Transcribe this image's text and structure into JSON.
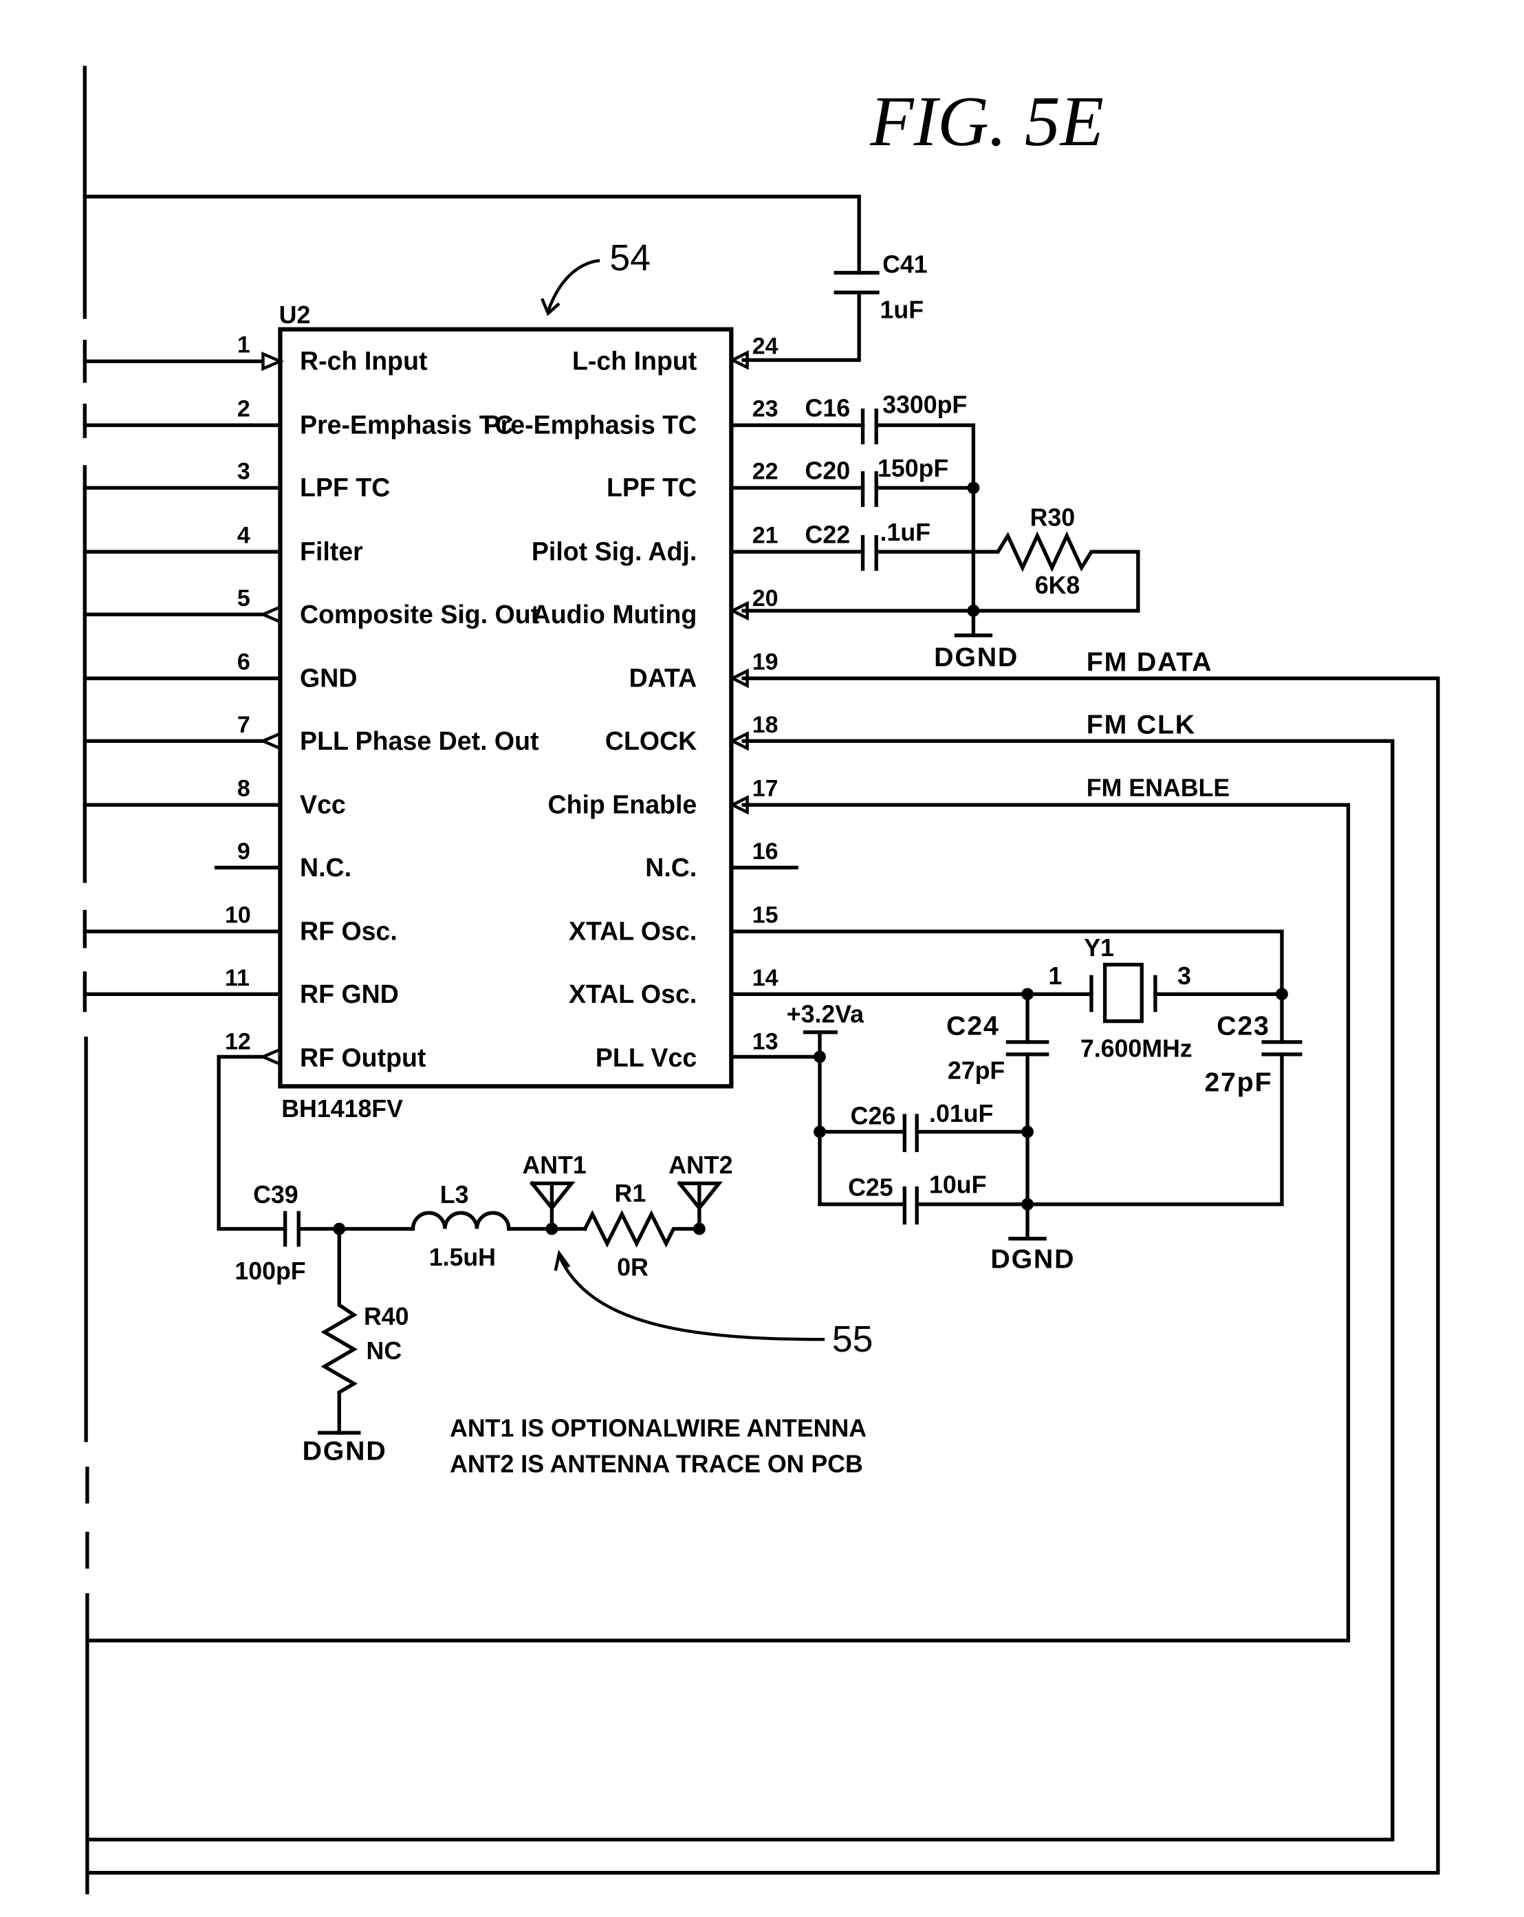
{
  "figure": {
    "title": "FIG. 5E"
  },
  "ic": {
    "ref": "U2",
    "part": "BH1418FV",
    "callout": "54",
    "left_pins": [
      {
        "num": "1",
        "label": "R-ch Input"
      },
      {
        "num": "2",
        "label": "Pre-Emphasis TC"
      },
      {
        "num": "3",
        "label": "LPF TC"
      },
      {
        "num": "4",
        "label": "Filter"
      },
      {
        "num": "5",
        "label": "Composite Sig. Out"
      },
      {
        "num": "6",
        "label": "GND"
      },
      {
        "num": "7",
        "label": "PLL Phase Det. Out"
      },
      {
        "num": "8",
        "label": "Vcc"
      },
      {
        "num": "9",
        "label": "N.C."
      },
      {
        "num": "10",
        "label": "RF Osc."
      },
      {
        "num": "11",
        "label": "RF GND"
      },
      {
        "num": "12",
        "label": "RF Output"
      }
    ],
    "right_pins": [
      {
        "num": "24",
        "label": "L-ch Input"
      },
      {
        "num": "23",
        "label": "Pre-Emphasis TC"
      },
      {
        "num": "22",
        "label": "LPF TC"
      },
      {
        "num": "21",
        "label": "Pilot Sig. Adj."
      },
      {
        "num": "20",
        "label": "Audio Muting"
      },
      {
        "num": "19",
        "label": "DATA"
      },
      {
        "num": "18",
        "label": "CLOCK"
      },
      {
        "num": "17",
        "label": "Chip Enable"
      },
      {
        "num": "16",
        "label": "N.C."
      },
      {
        "num": "15",
        "label": "XTAL Osc."
      },
      {
        "num": "14",
        "label": "XTAL Osc."
      },
      {
        "num": "13",
        "label": "PLL Vcc"
      }
    ]
  },
  "components": {
    "c41": {
      "ref": "C41",
      "value": "1uF"
    },
    "c16": {
      "ref": "C16",
      "value": "3300pF"
    },
    "c20": {
      "ref": "C20",
      "value": "150pF"
    },
    "c22": {
      "ref": "C22",
      "value": ".1uF"
    },
    "r30": {
      "ref": "R30",
      "value": "6K8"
    },
    "y1": {
      "ref": "Y1",
      "value": "7.600MHz",
      "pin_a": "1",
      "pin_b": "3"
    },
    "c24": {
      "ref": "C24",
      "value": "27pF"
    },
    "c23": {
      "ref": "C23",
      "value": "27pF"
    },
    "c26": {
      "ref": "C26",
      "value": ".01uF"
    },
    "c25": {
      "ref": "C25",
      "value": "10uF"
    },
    "c39": {
      "ref": "C39",
      "value": "100pF"
    },
    "l3": {
      "ref": "L3",
      "value": "1.5uH"
    },
    "r1": {
      "ref": "R1",
      "value": "0R"
    },
    "r40": {
      "ref": "R40",
      "value": "NC"
    },
    "ant1": {
      "ref": "ANT1"
    },
    "ant2": {
      "ref": "ANT2"
    }
  },
  "nets": {
    "dgnd": "DGND",
    "supply": "+3.2Va",
    "fm_data": "FM DATA",
    "fm_clk": "FM CLK",
    "fm_enable": "FM ENABLE"
  },
  "callouts": {
    "antenna": "55"
  },
  "notes": [
    "ANT1 IS OPTIONALWIRE ANTENNA",
    "ANT2 IS ANTENNA TRACE ON PCB"
  ]
}
